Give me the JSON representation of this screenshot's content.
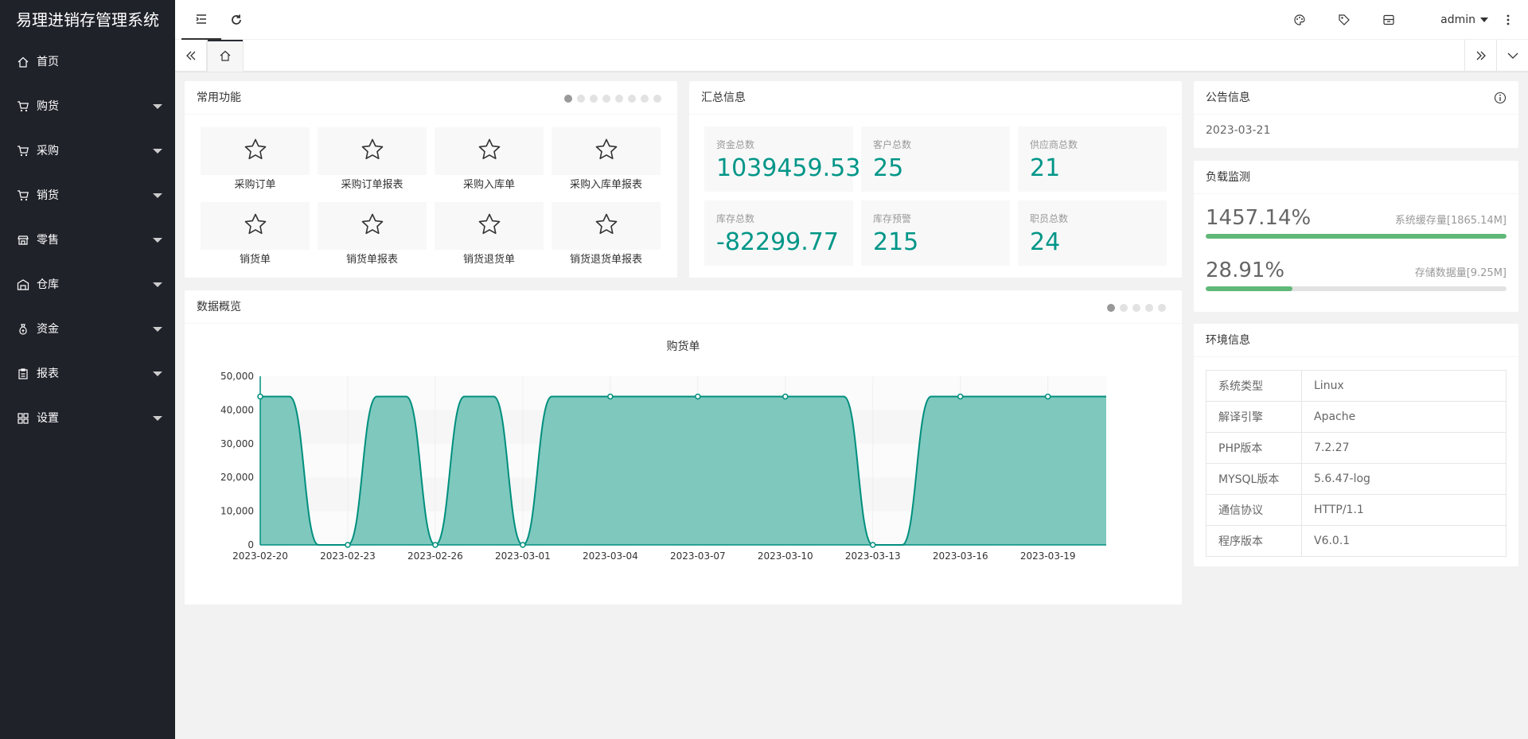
{
  "app": {
    "title": "易理进销存管理系统"
  },
  "sidebar": {
    "items": [
      {
        "label": "首页",
        "icon": "home-icon"
      },
      {
        "label": "购货",
        "icon": "cart-icon"
      },
      {
        "label": "采购",
        "icon": "cart-icon"
      },
      {
        "label": "销货",
        "icon": "cart-icon"
      },
      {
        "label": "零售",
        "icon": "store-icon"
      },
      {
        "label": "仓库",
        "icon": "warehouse-icon"
      },
      {
        "label": "资金",
        "icon": "money-bag-icon"
      },
      {
        "label": "报表",
        "icon": "clipboard-icon"
      },
      {
        "label": "设置",
        "icon": "grid-icon"
      }
    ]
  },
  "header": {
    "user": "admin"
  },
  "shortcuts": {
    "title": "常用功能",
    "items": [
      "采购订单",
      "采购订单报表",
      "采购入库单",
      "采购入库单报表",
      "销货单",
      "销货单报表",
      "销货退货单",
      "销货退货单报表"
    ],
    "pages": 8,
    "active_page": 0
  },
  "summary": {
    "title": "汇总信息",
    "stats": [
      {
        "label": "资金总数",
        "value": "1039459.53"
      },
      {
        "label": "客户总数",
        "value": "25"
      },
      {
        "label": "供应商总数",
        "value": "21"
      },
      {
        "label": "库存总数",
        "value": "-82299.77"
      },
      {
        "label": "库存预警",
        "value": "215"
      },
      {
        "label": "职员总数",
        "value": "24"
      }
    ]
  },
  "notice": {
    "title": "公告信息",
    "date": "2023-03-21"
  },
  "load": {
    "title": "负载监测",
    "rows": [
      {
        "percent_text": "1457.14%",
        "detail": "系统缓存量[1865.14M]",
        "fill": 1.0
      },
      {
        "percent_text": "28.91%",
        "detail": "存储数据量[9.25M]",
        "fill": 0.2891
      }
    ]
  },
  "env": {
    "title": "环境信息",
    "rows": [
      [
        "系统类型",
        "Linux"
      ],
      [
        "解译引擎",
        "Apache"
      ],
      [
        "PHP版本",
        "7.2.27"
      ],
      [
        "MYSQL版本",
        "5.6.47-log"
      ],
      [
        "通信协议",
        "HTTP/1.1"
      ],
      [
        "程序版本",
        "V6.0.1"
      ]
    ]
  },
  "overview": {
    "title": "数据概览",
    "pages": 5,
    "active_page": 0
  },
  "colors": {
    "accent": "#009688",
    "sidebar": "#20222a",
    "bar": "#5FB878"
  },
  "chart_data": {
    "type": "area",
    "title": "购货单",
    "x_labels": [
      "2023-02-20",
      "2023-02-23",
      "2023-02-26",
      "2023-03-01",
      "2023-03-04",
      "2023-03-07",
      "2023-03-10",
      "2023-03-13",
      "2023-03-16",
      "2023-03-19"
    ],
    "points": [
      [
        "2023-02-20",
        44000
      ],
      [
        "2023-02-21",
        44000
      ],
      [
        "2023-02-22",
        0
      ],
      [
        "2023-02-23",
        0
      ],
      [
        "2023-02-24",
        44000
      ],
      [
        "2023-02-25",
        44000
      ],
      [
        "2023-02-26",
        0
      ],
      [
        "2023-02-27",
        44000
      ],
      [
        "2023-02-28",
        44000
      ],
      [
        "2023-03-01",
        0
      ],
      [
        "2023-03-02",
        44000
      ],
      [
        "2023-03-03",
        44000
      ],
      [
        "2023-03-04",
        44000
      ],
      [
        "2023-03-05",
        44000
      ],
      [
        "2023-03-06",
        44000
      ],
      [
        "2023-03-07",
        44000
      ],
      [
        "2023-03-08",
        44000
      ],
      [
        "2023-03-09",
        44000
      ],
      [
        "2023-03-10",
        44000
      ],
      [
        "2023-03-11",
        44000
      ],
      [
        "2023-03-12",
        44000
      ],
      [
        "2023-03-13",
        0
      ],
      [
        "2023-03-14",
        0
      ],
      [
        "2023-03-15",
        44000
      ],
      [
        "2023-03-16",
        44000
      ],
      [
        "2023-03-17",
        44000
      ],
      [
        "2023-03-18",
        44000
      ],
      [
        "2023-03-19",
        44000
      ],
      [
        "2023-03-20",
        44000
      ],
      [
        "2023-03-21",
        44000
      ]
    ],
    "y_ticks": [
      "0",
      "10,000",
      "20,000",
      "30,000",
      "40,000",
      "50,000"
    ],
    "ylim": [
      0,
      50000
    ],
    "grid": true,
    "colors": {
      "line": "#008f7e",
      "area": "#7fc8bd"
    }
  }
}
